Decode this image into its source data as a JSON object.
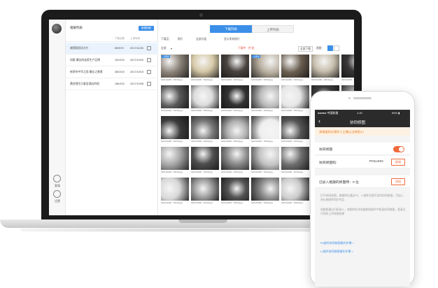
{
  "laptop": {
    "sidebar": {
      "title": "相册列表",
      "new_button": "新建相册",
      "columns": [
        "",
        "下载总数",
        "上传时间"
      ],
      "rows": [
        {
          "name": "湘西醉民风大片",
          "count": "800570",
          "date": "2017/11/08"
        },
        {
          "name": "如意-最佳的苗家生产品牌",
          "count": "100/100",
          "date": "2017/10/20"
        },
        {
          "name": "新郑市中华之现 最长之美食",
          "count": "383/100",
          "date": "2017/10/15"
        },
        {
          "name": "黄经理生日宴会酒店的相",
          "count": "166/100",
          "date": "2017/10/08"
        }
      ],
      "rail_labels": [
        "客服",
        "设置"
      ]
    },
    "tabs": {
      "download": "下载列表",
      "upload": "上传列表"
    },
    "toolbar": {
      "label1": "下载至:",
      "select1": "照片",
      "select2": "全部分组",
      "action1": "显示所有照片",
      "red_text": "下载中 · 共  张",
      "right_btn": "全部下载",
      "view_label": "视图"
    },
    "toolbar2": {
      "filter": "全部",
      "sort": "▾"
    },
    "thumbnails": {
      "caption": "IGOUHAIR...72410.jpg",
      "tag": "上传中",
      "tones": [
        [
          "#8a8177",
          "#d6c9a8",
          "#4a4440",
          "#b9b0a0",
          "#6a5e50",
          "#c8bfae",
          "#3a3838",
          "#a09890",
          "#201c1c",
          "#f2f2f2"
        ],
        [
          "#5a5a5a",
          "#dddddd",
          "#333333",
          "#bbbbbb",
          "#e6e6e6",
          "#404040",
          "#9a9a9a",
          "#1f1f1f",
          "#777777",
          "#cfcfcf"
        ],
        [
          "#3c3c3c",
          "#7a7a7a",
          "#b0b0b0",
          "#eeeeee",
          "#555555",
          "#9c9c9c",
          "#2a2a2a",
          "#d0d0d0",
          "#646464",
          "#181818"
        ],
        [
          "#a5a5a5",
          "#4f4f4f",
          "#8d8d8d",
          "#c3c3c3",
          "#6e6e6e",
          "#e0e0e0",
          "#383838",
          "#999999",
          "#5c5c5c",
          "#b7b7b7"
        ],
        [
          "#d8d8d8",
          "#9e9e9e",
          "#555555",
          "#8a8a8a",
          "#cccccc",
          "#6a6a6a",
          "#b0b0b0",
          "#404040",
          "#e5e5e5",
          "#777777"
        ]
      ]
    }
  },
  "phone": {
    "status": {
      "left": "●●●●● 中国联通",
      "time": "1:20",
      "right": "90% ▮"
    },
    "nav_title": "协同修图",
    "back_icon": "chevron-left-icon",
    "warning": "请根据所示操作人工确认过修图人!",
    "toggle_label": "协同修图",
    "code_label": "协同修图码:",
    "code_value": "POUJHG",
    "copy_button": "复制",
    "added_label": "已加入相册的修图师：0 位",
    "add_button": "添加",
    "desc1": "打开协同修图，修图师在通过PS、Lr插件后即可实时协同修图，可加入多位修图师同步作品",
    "desc2": "电脑版通过扫码进入，修图师在浏览器修图插件中登录协同修图，登录后可同时上传修图结果",
    "link1": "Ps插件协同修图操作步骤 >",
    "link2": "Lr插件协同修图操作步骤 >"
  }
}
